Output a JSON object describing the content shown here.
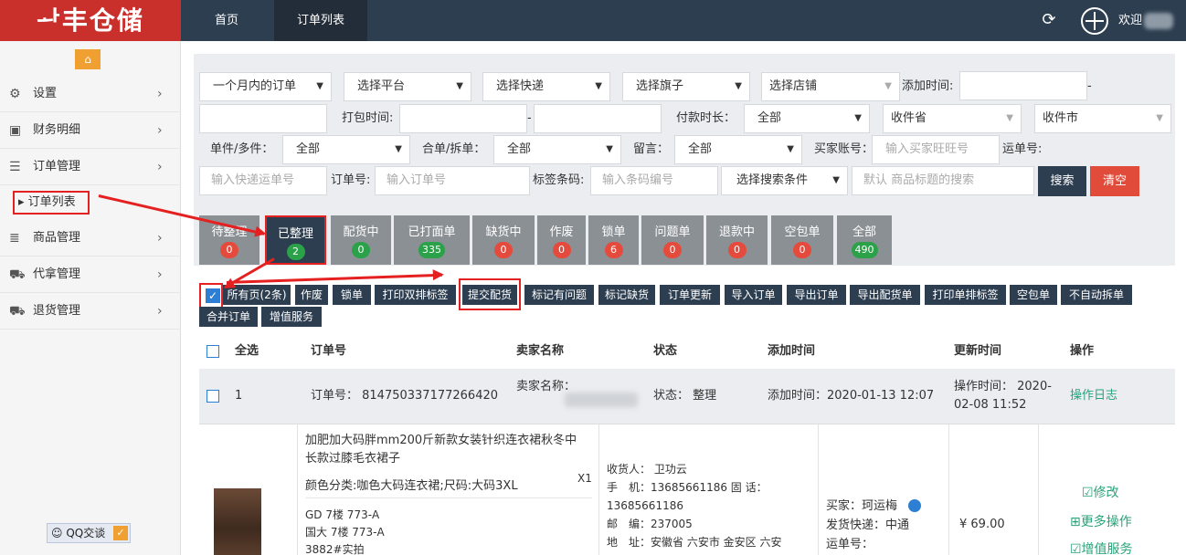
{
  "header": {
    "logo": "ᅪ丰仓储",
    "nav": [
      "首页",
      "订单列表"
    ],
    "welcome": "欢迎"
  },
  "sidebar": {
    "items": [
      {
        "label": "设置",
        "icon": "gear-icon"
      },
      {
        "label": "财务明细",
        "icon": "briefcase-icon"
      },
      {
        "label": "订单管理",
        "icon": "menu-icon"
      },
      {
        "label": "商品管理",
        "icon": "list-icon"
      },
      {
        "label": "代拿管理",
        "icon": "cart-icon"
      },
      {
        "label": "退货管理",
        "icon": "truck-icon"
      }
    ],
    "sub_item": "订单列表",
    "qq": "QQ交谈"
  },
  "filters": {
    "time_range": "一个月内的订单",
    "platform": "选择平台",
    "express": "选择快递",
    "flag": "选择旗子",
    "shop": "选择店铺",
    "add_time_label": "添加时间:",
    "pack_time_label": "打包时间:",
    "pay_duration_label": "付款时长：",
    "pay_duration_value": "全部",
    "province": "收件省",
    "city": "收件市",
    "single_multi_label": "单件/多件：",
    "single_multi_value": "全部",
    "merge_split_label": "合单/拆单：",
    "merge_split_value": "全部",
    "message_label": "留言：",
    "message_value": "全部",
    "buyer_label": "买家账号：",
    "buyer_placeholder": "输入买家旺旺号",
    "waybill_label": "运单号:",
    "waybill_placeholder": "输入快递运单号",
    "order_label": "订单号:",
    "order_placeholder": "输入订单号",
    "barcode_label": "标签条码:",
    "barcode_placeholder": "输入条码编号",
    "search_cond": "选择搜索条件",
    "keyword_placeholder": "默认 商品标题的搜索",
    "search_btn": "搜索",
    "clear_btn": "清空",
    "separator": "-"
  },
  "status_tabs": [
    {
      "label": "待整理",
      "count": "0"
    },
    {
      "label": "已整理",
      "count": "2"
    },
    {
      "label": "配货中",
      "count": "0"
    },
    {
      "label": "已打面单",
      "count": "335"
    },
    {
      "label": "缺货中",
      "count": "0"
    },
    {
      "label": "作废",
      "count": "0"
    },
    {
      "label": "锁单",
      "count": "6"
    },
    {
      "label": "问题单",
      "count": "0"
    },
    {
      "label": "退款中",
      "count": "0"
    },
    {
      "label": "空包单",
      "count": "0"
    },
    {
      "label": "全部",
      "count": "490"
    }
  ],
  "actions": {
    "all_pages": "所有页(2条)",
    "buttons": [
      "作废",
      "锁单",
      "打印双排标签",
      "提交配货",
      "标记有问题",
      "标记缺货",
      "订单更新",
      "导入订单",
      "导出订单",
      "导出配货单",
      "打印单排标签",
      "空包单",
      "不自动拆单",
      "合并订单",
      "增值服务"
    ]
  },
  "table": {
    "headers": [
      "全选",
      "订单号",
      "卖家名称",
      "状态",
      "添加时间",
      "更新时间",
      "操作"
    ],
    "row": {
      "index": "1",
      "order_no": "订单号： 814750337177266420",
      "seller": "卖家名称：",
      "status": "状态： 整理",
      "add_time": "添加时间：2020-01-13 12:07",
      "update_time_1": "操作时间： 2020-",
      "update_time_2": "02-08 11:52",
      "log_link": "操作日志"
    },
    "detail": {
      "title_1": "加肥加大码胖mm200斤新款女装针织连衣裙秋冬中",
      "title_2": "长款过膝毛衣裙子",
      "spec": "颜色分类:咖色大码连衣裙;尺码:大码3XL",
      "qty": "X1",
      "loc_1": "GD 7楼 773-A",
      "loc_2": "国大 7楼 773-A",
      "loc_3": "3882#实拍",
      "receiver": "收货人：  卫功云",
      "mobile": "手　机：13685661186  固 话：",
      "phone2": "13685661186",
      "zip": "邮　编：237005",
      "addr": "地　址：安徽省 六安市 金安区 六安",
      "buyer": "买家：珂运梅",
      "express": "发货快递：中通",
      "waybill": "运单号：",
      "price": "¥ 69.00",
      "modify": "☑修改",
      "more": "⊞更多操作",
      "value_added": "☑增值服务"
    }
  }
}
